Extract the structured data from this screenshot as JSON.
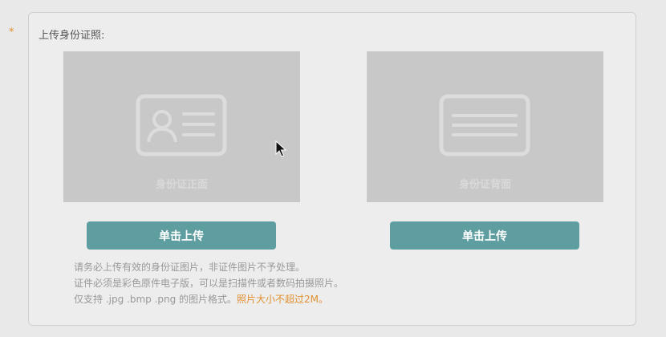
{
  "form": {
    "required_mark": "*",
    "label": "上传身份证照:"
  },
  "cards": {
    "front": {
      "caption": "身份证正面",
      "icon": "id-card-front-icon",
      "button_label": "单击上传"
    },
    "back": {
      "caption": "身份证背面",
      "icon": "id-card-back-icon",
      "button_label": "单击上传"
    }
  },
  "hints": {
    "line1": "请务必上传有效的身份证图片，非证件图片不予处理。",
    "line2": "证件必须是彩色原件电子版，可以是扫描件或者数码拍摄照片。",
    "line3": "仅支持 .jpg .bmp .png 的图片格式。",
    "line3_warning": "照片大小不超过2M。"
  },
  "colors": {
    "accent": "#5f9ea0",
    "warning": "#e0902f",
    "placeholder_bg": "#c8c8c8"
  }
}
